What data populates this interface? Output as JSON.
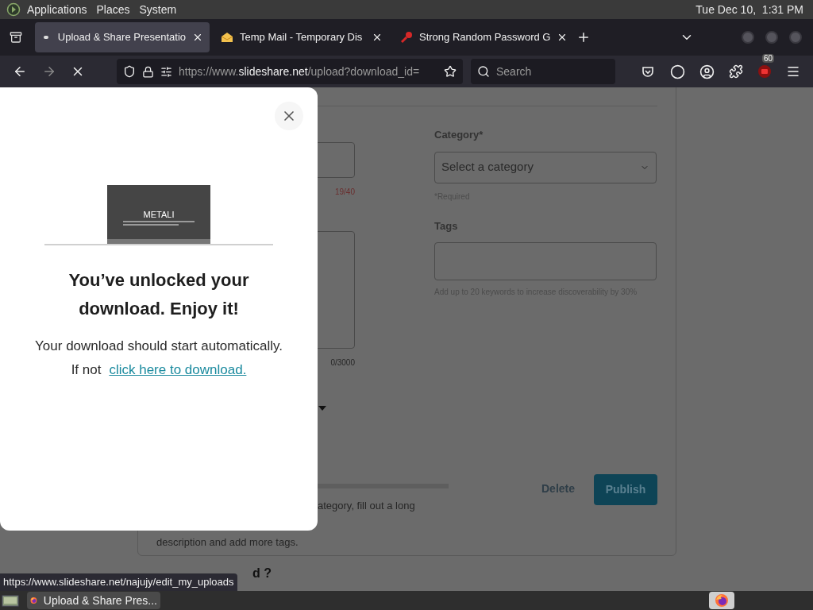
{
  "top_panel": {
    "menus": [
      "Applications",
      "Places",
      "System"
    ],
    "clock": "Tue Dec 10,  1:31 PM"
  },
  "tabs": [
    {
      "title": "Upload & Share Presentatio",
      "kind": "blank",
      "selected": true
    },
    {
      "title": "Temp Mail - Temporary Dis",
      "kind": "mail",
      "selected": false
    },
    {
      "title": "Strong Random Password G",
      "kind": "key",
      "selected": false
    }
  ],
  "toolbar": {
    "url_host": "https://www.slideshare.net",
    "url_path": "/upload?download_id=",
    "search_placeholder": "Search",
    "badge": "60"
  },
  "page": {
    "category_label": "Category*",
    "category_select": "Select a category",
    "required_note": "*Required",
    "tags_label": "Tags",
    "tags_hint": "Add up to 20 keywords to increase discoverability by 30%",
    "title_counter": "19/40",
    "description_counter": "0/3000",
    "tip_line_1": "ategory, fill out a long",
    "tip_line_2": "description and add more tags.",
    "delete": "Delete",
    "publish": "Publish",
    "next_heading": "d ?"
  },
  "modal": {
    "slide_title": "METALI",
    "heading": "You’ve unlocked your download. Enjoy it!",
    "body": "Your download should start automatically.",
    "link_prefix": "If not",
    "link": "click here to download."
  },
  "status_url": "https://www.slideshare.net/najujy/edit_my_uploads",
  "taskbar": {
    "window": "Upload & Share Pres..."
  }
}
